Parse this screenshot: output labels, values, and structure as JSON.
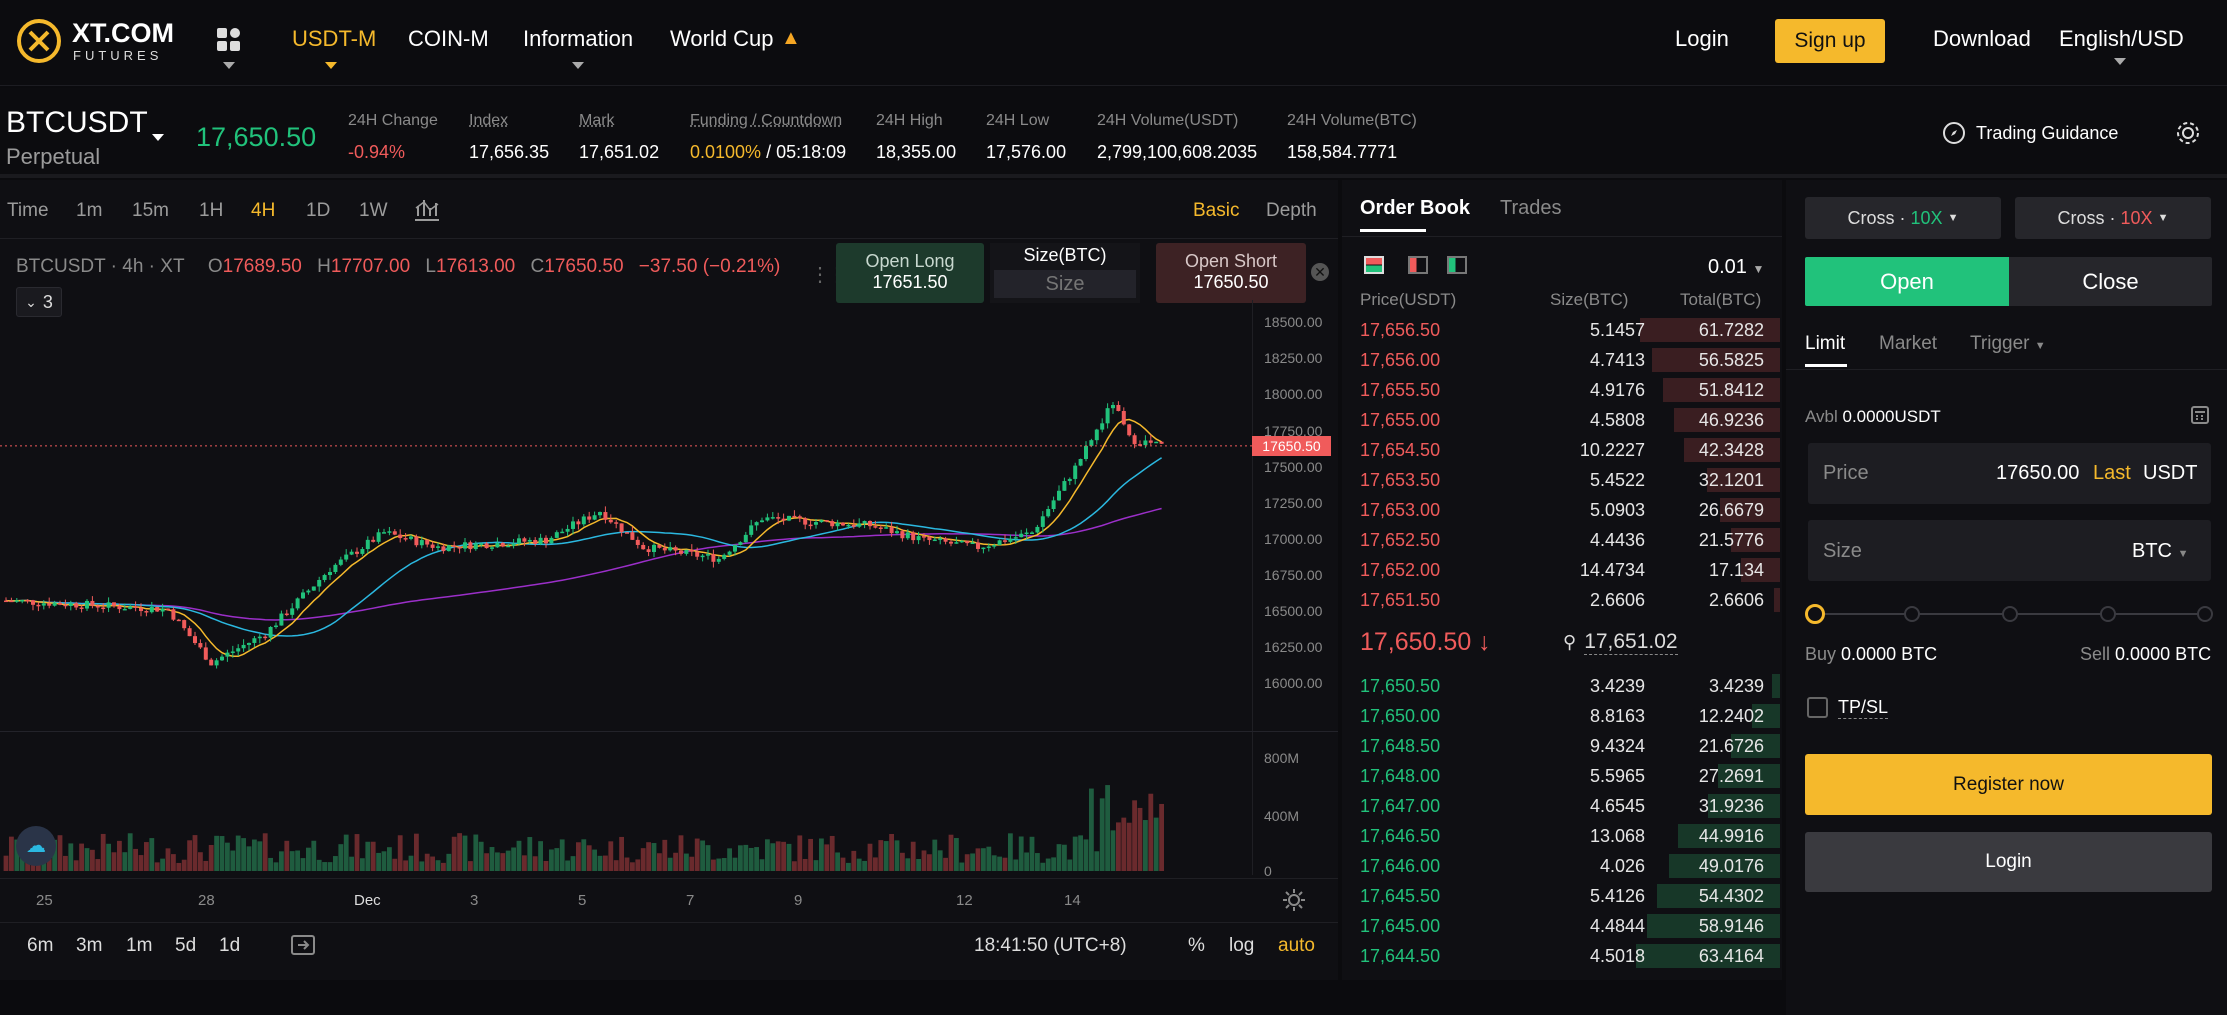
{
  "nav": {
    "logo_main": "XT.COM",
    "logo_sub": "FUTURES",
    "items": [
      "USDT-M",
      "COIN-M",
      "Information",
      "World Cup"
    ],
    "login": "Login",
    "signup": "Sign up",
    "download": "Download",
    "lang": "English/USD"
  },
  "ticker": {
    "symbol": "BTCUSDT",
    "type": "Perpetual",
    "price": "17,650.50",
    "stats": [
      {
        "label": "24H Change",
        "value": "-0.94%"
      },
      {
        "label": "Index",
        "value": "17,656.35"
      },
      {
        "label": "Mark",
        "value": "17,651.02"
      },
      {
        "label": "Funding / Countdown",
        "value_a": "0.0100%",
        "value_sep": " / ",
        "value_b": "05:18:09"
      },
      {
        "label": "24H High",
        "value": "18,355.00"
      },
      {
        "label": "24H Low",
        "value": "17,576.00"
      },
      {
        "label": "24H Volume(USDT)",
        "value": "2,799,100,608.2035"
      },
      {
        "label": "24H Volume(BTC)",
        "value": "158,584.7771"
      }
    ],
    "guidance": "Trading Guidance"
  },
  "chart_toolbar": {
    "timeframes": [
      "Time",
      "1m",
      "15m",
      "1H",
      "4H",
      "1D",
      "1W"
    ],
    "active": "4H",
    "basic": "Basic",
    "depth": "Depth"
  },
  "chart_legend": {
    "title": "BTCUSDT · 4h · XT",
    "o_label": "O",
    "o": "17689.50",
    "h_label": "H",
    "h": "17707.00",
    "l_label": "L",
    "l": "17613.00",
    "c_label": "C",
    "c": "17650.50",
    "chg": "−37.50 (−0.21%)",
    "indicator_count": "3"
  },
  "quick_trade": {
    "open_long": "Open Long",
    "long_price": "17651.50",
    "size_label": "Size(BTC)",
    "size_placeholder": "Size",
    "open_short": "Open Short",
    "short_price": "17650.50"
  },
  "chart_data": {
    "type": "candlestick",
    "y_ticks": [
      "18500.00",
      "18250.00",
      "18000.00",
      "17750.00",
      "17500.00",
      "17250.00",
      "17000.00",
      "16750.00",
      "16500.00",
      "16250.00",
      "16000.00"
    ],
    "ylim": [
      15850,
      18550
    ],
    "last_price_label": "17650.50",
    "last_price": 17650.5,
    "vol_ticks": [
      "800M",
      "400M",
      "0"
    ],
    "x_ticks": [
      "25",
      "28",
      "Dec",
      "3",
      "5",
      "7",
      "9",
      "12",
      "14"
    ],
    "colors": {
      "up": "#21c27b",
      "down": "#f05b5b",
      "ma1": "#f5b92c",
      "ma2": "#2bb8e0",
      "ma3": "#9b2fc9"
    }
  },
  "chart_footer": {
    "ranges": [
      "6m",
      "3m",
      "1m",
      "5d",
      "1d"
    ],
    "time": "18:41:50 (UTC+8)",
    "pct": "%",
    "log": "log",
    "auto": "auto"
  },
  "orderbook": {
    "tabs": [
      "Order Book",
      "Trades"
    ],
    "precision": "0.01",
    "headers": [
      "Price(USDT)",
      "Size(BTC)",
      "Total(BTC)"
    ],
    "asks": [
      [
        "17,656.50",
        "5.1457",
        "61.7282"
      ],
      [
        "17,656.00",
        "4.7413",
        "56.5825"
      ],
      [
        "17,655.50",
        "4.9176",
        "51.8412"
      ],
      [
        "17,655.00",
        "4.5808",
        "46.9236"
      ],
      [
        "17,654.50",
        "10.2227",
        "42.3428"
      ],
      [
        "17,653.50",
        "5.4522",
        "32.1201"
      ],
      [
        "17,653.00",
        "5.0903",
        "26.6679"
      ],
      [
        "17,652.50",
        "4.4436",
        "21.5776"
      ],
      [
        "17,652.00",
        "14.4734",
        "17.134"
      ],
      [
        "17,651.50",
        "2.6606",
        "2.6606"
      ]
    ],
    "mid_price": "17,650.50",
    "mark_price": "17,651.02",
    "bids": [
      [
        "17,650.50",
        "3.4239",
        "3.4239"
      ],
      [
        "17,650.00",
        "8.8163",
        "12.2402"
      ],
      [
        "17,648.50",
        "9.4324",
        "21.6726"
      ],
      [
        "17,648.00",
        "5.5965",
        "27.2691"
      ],
      [
        "17,647.00",
        "4.6545",
        "31.9236"
      ],
      [
        "17,646.50",
        "13.068",
        "44.9916"
      ],
      [
        "17,646.00",
        "4.026",
        "49.0176"
      ],
      [
        "17,645.50",
        "5.4126",
        "54.4302"
      ],
      [
        "17,645.00",
        "4.4844",
        "58.9146"
      ],
      [
        "17,644.50",
        "4.5018",
        "63.4164"
      ]
    ]
  },
  "trade": {
    "margin_left": "Cross",
    "lev_left": "10X",
    "margin_right": "Cross",
    "lev_right": "10X",
    "open": "Open",
    "close": "Close",
    "order_types": [
      "Limit",
      "Market",
      "Trigger"
    ],
    "avbl_label": "Avbl",
    "avbl_value": "0.0000USDT",
    "price_label": "Price",
    "price_value": "17650.00",
    "last": "Last",
    "price_unit": "USDT",
    "size_label": "Size",
    "size_unit": "BTC",
    "buy_label": "Buy",
    "buy_value": "0.0000 BTC",
    "sell_label": "Sell",
    "sell_value": "0.0000 BTC",
    "tpsl": "TP/SL",
    "register": "Register now",
    "login": "Login"
  }
}
